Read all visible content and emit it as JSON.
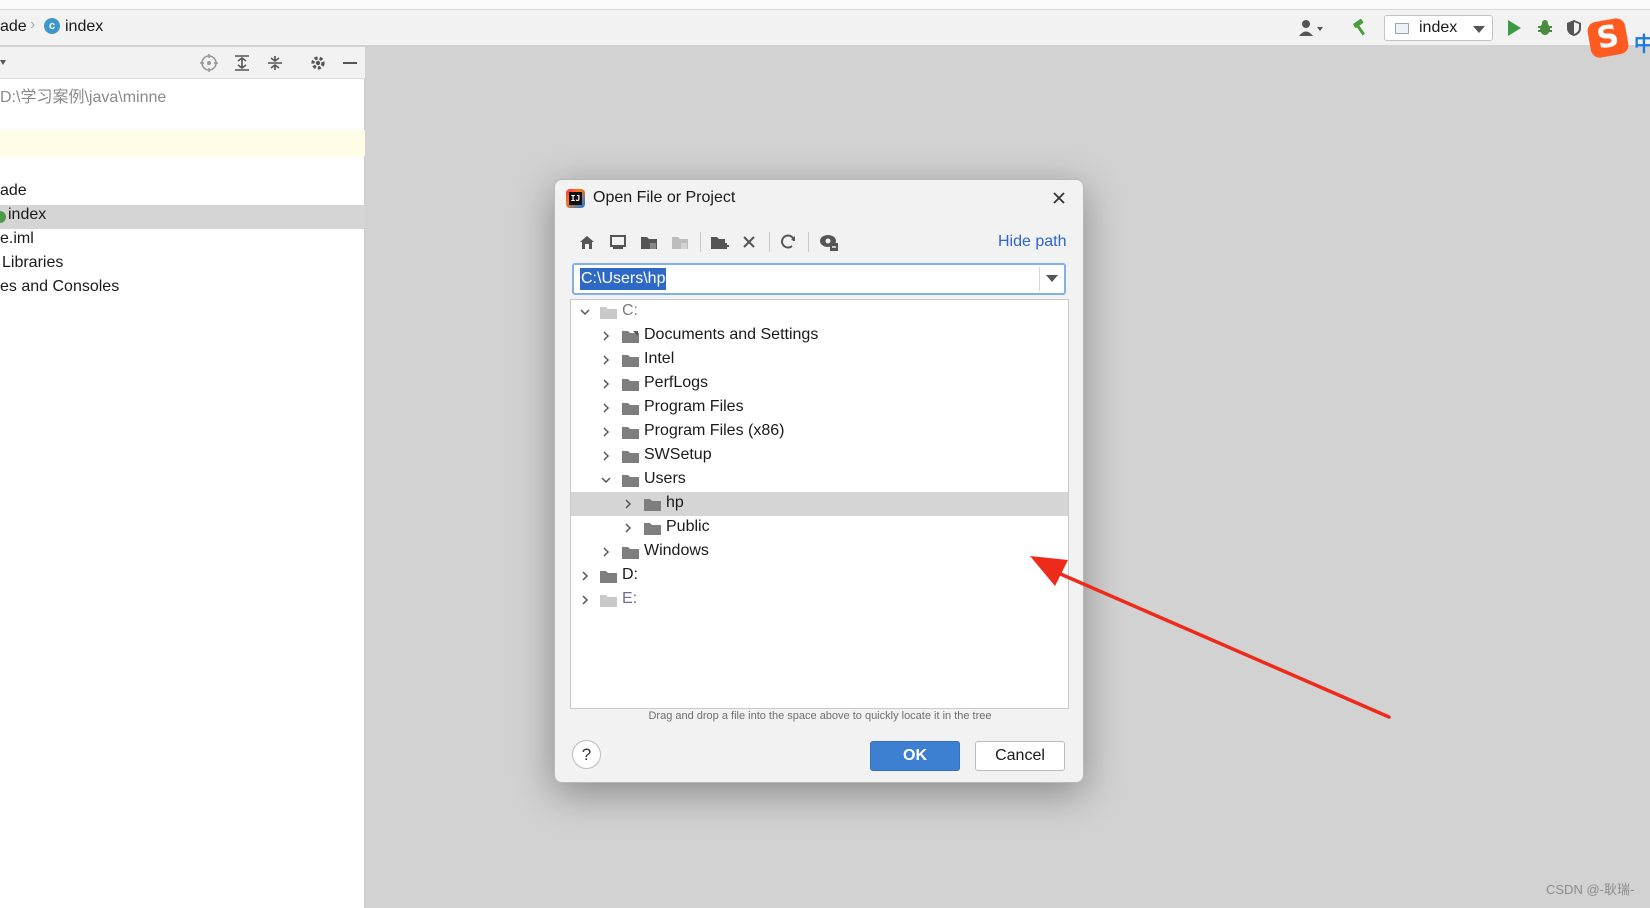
{
  "breadcrumb": {
    "project": "ade",
    "file": "index",
    "class_icon_letter": "c"
  },
  "toolbar": {
    "run_config": "index",
    "ime_label": "中",
    "sogou_logo": "S"
  },
  "project_panel": {
    "path": "D:\\学习案例\\java\\minne",
    "items": [
      "ade",
      "index",
      "e.iml",
      "Libraries",
      "es and Consoles"
    ]
  },
  "dialog": {
    "title": "Open File or Project",
    "hide_path": "Hide path",
    "path_value": "C:\\Users\\hp",
    "tree": [
      {
        "label": "C:",
        "expanded": true
      },
      {
        "label": "Documents and Settings",
        "expanded": false
      },
      {
        "label": "Intel",
        "expanded": false
      },
      {
        "label": "PerfLogs",
        "expanded": false
      },
      {
        "label": "Program Files",
        "expanded": false
      },
      {
        "label": "Program Files (x86)",
        "expanded": false
      },
      {
        "label": "SWSetup",
        "expanded": false
      },
      {
        "label": "Users",
        "expanded": true
      },
      {
        "label": "hp",
        "expanded": false,
        "selected": true
      },
      {
        "label": "Public",
        "expanded": false
      },
      {
        "label": "Windows",
        "expanded": false
      },
      {
        "label": "D:",
        "expanded": false
      },
      {
        "label": "E:",
        "expanded": false
      }
    ],
    "hint": "Drag and drop a file into the space above to quickly locate it in the tree",
    "help": "?",
    "ok": "OK",
    "cancel": "Cancel"
  },
  "watermark": "CSDN @-耿瑞-",
  "colors": {
    "accent": "#3d7fd0",
    "link": "#2f65ca",
    "selection": "#2e69c5",
    "annotation_arrow": "#ee2a1a"
  }
}
